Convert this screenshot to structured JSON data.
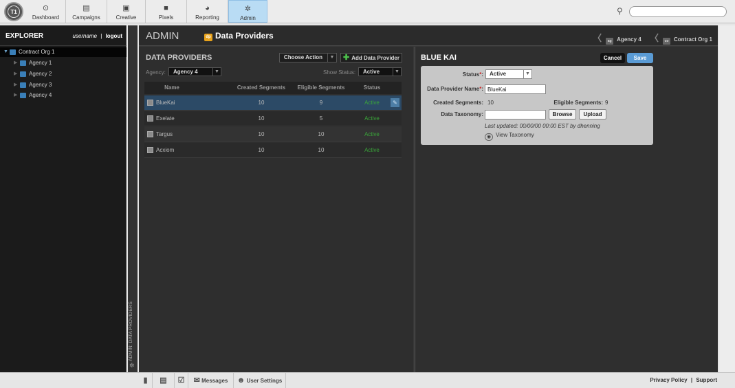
{
  "topnav": {
    "logo_text": "T1",
    "items": [
      {
        "label": "Dashboard",
        "icon": "dashboard-icon",
        "glyph": "⊙"
      },
      {
        "label": "Campaigns",
        "icon": "campaigns-icon",
        "glyph": "▤"
      },
      {
        "label": "Creative",
        "icon": "creative-icon",
        "glyph": "▣"
      },
      {
        "label": "Pixels",
        "icon": "pixels-icon",
        "glyph": "■"
      },
      {
        "label": "Reporting",
        "icon": "reporting-icon",
        "glyph": "◕"
      },
      {
        "label": "Admin",
        "icon": "admin-gear-icon",
        "glyph": "✲"
      }
    ],
    "active": "Admin",
    "search_glyph": "⚲"
  },
  "sidebar": {
    "title": "EXPLORER",
    "username": "username",
    "sep": "|",
    "logout": "logout",
    "tree": {
      "root": {
        "label": "Contract Org 1"
      },
      "children": [
        {
          "label": "Agency 1"
        },
        {
          "label": "Agency 2"
        },
        {
          "label": "Agency 3"
        },
        {
          "label": "Agency 4"
        }
      ]
    },
    "vertical_label": "ADMIN: DATA PROVIDERS"
  },
  "header": {
    "section": "ADMIN",
    "badge": "dp",
    "title": "Data Providers",
    "breadcrumbs": [
      {
        "badge": "ag",
        "label": "Agency 4"
      },
      {
        "badge": "co",
        "label": "Contract Org 1"
      }
    ]
  },
  "left_panel": {
    "title": "DATA PROVIDERS",
    "choose_action": "Choose Action",
    "add_button": "Add Data Provider",
    "agency_label": "Agency:",
    "agency_value": "Agency 4",
    "show_status_label": "Show Status:",
    "show_status_value": "Active",
    "columns": [
      "Name",
      "Created Segments",
      "Eligible Segments",
      "Status"
    ],
    "rows": [
      {
        "name": "BlueKai",
        "created": "10",
        "eligible": "9",
        "status": "Active"
      },
      {
        "name": "Exelate",
        "created": "10",
        "eligible": "5",
        "status": "Active"
      },
      {
        "name": "Targus",
        "created": "10",
        "eligible": "10",
        "status": "Active"
      },
      {
        "name": "Acxiom",
        "created": "10",
        "eligible": "10",
        "status": "Active"
      }
    ],
    "selected_row": "BlueKai"
  },
  "detail": {
    "title": "BLUE KAI",
    "cancel": "Cancel",
    "save": "Save",
    "status_label": "Status",
    "status_value": "Active",
    "name_label": "Data Provider Name",
    "name_value": "BlueKai",
    "created_label": "Created Segments:",
    "created_value": "10",
    "eligible_label": "Eligible Segments:",
    "eligible_value": "9",
    "taxonomy_label": "Data Taxonomy:",
    "browse": "Browse",
    "upload": "Upload",
    "last_updated": "Last updated: 00/00/00 00:00 EST by dhenning",
    "view_taxonomy": "View Taxonomy",
    "required_mark": "*",
    "colon": ":"
  },
  "bottombar": {
    "messages": "Messages",
    "user_settings": "User Settings",
    "privacy": "Privacy Policy",
    "sep": "|",
    "support": "Support"
  },
  "colors": {
    "accent_blue": "#5a9bd5",
    "active_green": "#3aa53a",
    "dp_orange": "#e9a31b",
    "admin_active_bg": "#b9dcf4"
  }
}
